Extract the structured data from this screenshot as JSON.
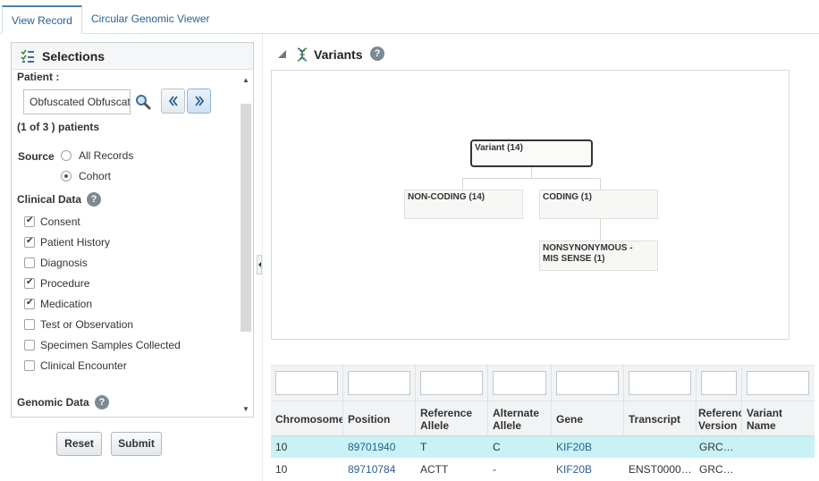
{
  "tabs": [
    {
      "label": "View Record",
      "active": true
    },
    {
      "label": "Circular Genomic Viewer",
      "active": false
    }
  ],
  "selections": {
    "title": "Selections",
    "patient_label": "Patient :",
    "patient_value": "Obfuscated  Obfuscated",
    "patients_count": "(1 of 3 ) patients",
    "source_label": "Source",
    "source_options": [
      {
        "label": "All Records",
        "selected": false
      },
      {
        "label": "Cohort",
        "selected": true
      }
    ],
    "clinical_data_label": "Clinical Data",
    "clinical_items": [
      {
        "label": "Consent",
        "checked": true
      },
      {
        "label": "Patient History",
        "checked": true
      },
      {
        "label": "Diagnosis",
        "checked": false
      },
      {
        "label": "Procedure",
        "checked": true
      },
      {
        "label": "Medication",
        "checked": true
      },
      {
        "label": "Test or Observation",
        "checked": false
      },
      {
        "label": "Specimen Samples Collected",
        "checked": false
      },
      {
        "label": "Clinical Encounter",
        "checked": false
      }
    ],
    "genomic_data_label": "Genomic Data",
    "reset_label": "Reset",
    "submit_label": "Submit"
  },
  "variants": {
    "title": "Variants",
    "tree": {
      "root": "Variant (14)",
      "noncoding": "NON-CODING (14)",
      "coding": "CODING (1)",
      "missense_line1": "NONSYNONYMOUS -",
      "missense_line2": "MIS SENSE (1)"
    }
  },
  "table": {
    "columns": [
      "Chromosome",
      "Position",
      "Reference Allele",
      "Alternate Allele",
      "Gene",
      "Transcript",
      "Reference Version",
      "Variant Name"
    ],
    "rows": [
      [
        "10",
        "89701940",
        "T",
        "C",
        "KIF20B",
        "",
        "GRC…",
        ""
      ],
      [
        "10",
        "89710784",
        "ACTT",
        "-",
        "KIF20B",
        "ENST0000…",
        "GRC…",
        ""
      ]
    ]
  },
  "help_glyph": "?",
  "colors": {
    "accent": "#2a5f8f",
    "selected_row": "#c8f2f4"
  }
}
